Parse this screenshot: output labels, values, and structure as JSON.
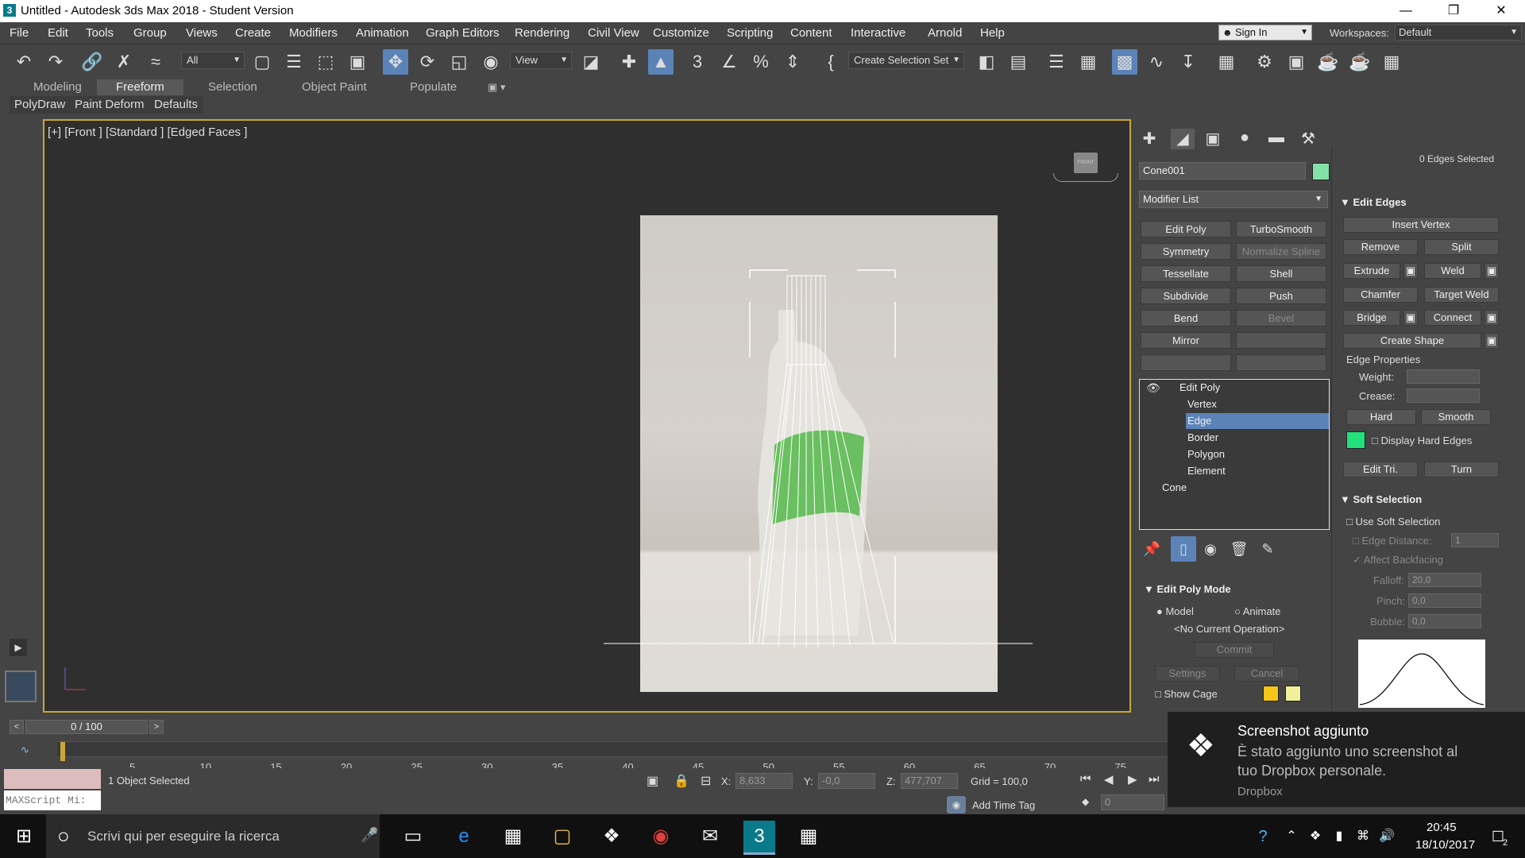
{
  "titlebar": {
    "title": "Untitled - Autodesk 3ds Max 2018 - Student Version",
    "app_icon": "3",
    "minimize": "—",
    "maximize": "❐",
    "close": "✕"
  },
  "menu": [
    "File",
    "Edit",
    "Tools",
    "Group",
    "Views",
    "Create",
    "Modifiers",
    "Animation",
    "Graph Editors",
    "Rendering",
    "Civil View",
    "Customize",
    "Scripting",
    "Content",
    "Interactive",
    "Arnold",
    "Help"
  ],
  "signin": {
    "label": "Sign In"
  },
  "workspace": {
    "label": "Workspaces:",
    "value": "Default"
  },
  "toolbar": {
    "filter": "All",
    "refcoord": "View",
    "selset": "Create Selection Set"
  },
  "ribbon_tabs": [
    "Modeling",
    "Freeform",
    "Selection",
    "Object Paint",
    "Populate"
  ],
  "ribbon_active": "Freeform",
  "ribbon_sub": [
    "PolyDraw",
    "Paint Deform",
    "Defaults"
  ],
  "viewport": {
    "label": "[+] [Front ] [Standard ] [Edged Faces ]",
    "viewcube": "FRONT"
  },
  "panel": {
    "object_name": "Cone001",
    "modifier_list": "Modifier List",
    "buttons": [
      {
        "label": "Edit Poly",
        "enabled": true
      },
      {
        "label": "TurboSmooth",
        "enabled": true
      },
      {
        "label": "Symmetry",
        "enabled": true
      },
      {
        "label": "Normalize Spline",
        "enabled": false
      },
      {
        "label": "Tessellate",
        "enabled": true
      },
      {
        "label": "Shell",
        "enabled": true
      },
      {
        "label": "Subdivide",
        "enabled": true
      },
      {
        "label": "Push",
        "enabled": true
      },
      {
        "label": "Bend",
        "enabled": true
      },
      {
        "label": "Bevel",
        "enabled": false
      },
      {
        "label": "Mirror",
        "enabled": true
      },
      {
        "label": "",
        "enabled": false
      },
      {
        "label": "",
        "enabled": false
      },
      {
        "label": "",
        "enabled": false
      }
    ],
    "stack": [
      {
        "label": "Edit Poly",
        "level": 0,
        "selected": false
      },
      {
        "label": "Vertex",
        "level": 1,
        "selected": false
      },
      {
        "label": "Edge",
        "level": 1,
        "selected": true
      },
      {
        "label": "Border",
        "level": 1,
        "selected": false
      },
      {
        "label": "Polygon",
        "level": 1,
        "selected": false
      },
      {
        "label": "Element",
        "level": 1,
        "selected": false
      },
      {
        "label": "Cone",
        "level": 0,
        "selected": false
      }
    ],
    "edit_poly_mode": {
      "title": "Edit Poly Mode",
      "model": "Model",
      "animate": "Animate",
      "operation": "<No Current Operation>",
      "commit": "Commit",
      "settings": "Settings",
      "cancel": "Cancel",
      "show_cage": "Show Cage",
      "cage_color1": "#f5c518",
      "cage_color2": "#f2ef9a"
    }
  },
  "edges": {
    "selected_count": "0 Edges Selected",
    "title": "Edit Edges",
    "insert_vertex": "Insert Vertex",
    "remove": "Remove",
    "split": "Split",
    "extrude": "Extrude",
    "weld": "Weld",
    "chamfer": "Chamfer",
    "target_weld": "Target Weld",
    "bridge": "Bridge",
    "connect": "Connect",
    "create_shape": "Create Shape",
    "edge_props": "Edge Properties",
    "weight": "Weight:",
    "crease": "Crease:",
    "hard": "Hard",
    "smooth": "Smooth",
    "display_hard": "Display Hard Edges",
    "hard_color": "#22e07a",
    "edit_tri": "Edit Tri.",
    "turn": "Turn"
  },
  "soft": {
    "title": "Soft Selection",
    "use": "Use Soft Selection",
    "edge_distance": "Edge Distance:",
    "edge_distance_val": "1",
    "affect_back": "Affect Backfacing",
    "falloff": "Falloff:",
    "falloff_val": "20,0",
    "pinch": "Pinch:",
    "pinch_val": "0,0",
    "bubble": "Bubble:",
    "bubble_val": "0,0"
  },
  "timeline": {
    "frame": "0 / 100",
    "ticks": [
      "5",
      "10",
      "15",
      "20",
      "25",
      "30",
      "35",
      "40",
      "45",
      "50",
      "55",
      "60",
      "65",
      "70",
      "75"
    ]
  },
  "status": {
    "maxscript": "MAXScript Mi:",
    "selected": "1 Object Selected",
    "x_label": "X:",
    "x": "8,633",
    "y_label": "Y:",
    "y": "-0,0",
    "z_label": "Z:",
    "z": "477,707",
    "grid": "Grid = 100,0",
    "add_time_tag": "Add Time Tag",
    "frame": "0"
  },
  "toast": {
    "title": "Screenshot aggiunto",
    "body1": "È stato aggiunto uno screenshot al",
    "body2": "tuo Dropbox personale.",
    "source": "Dropbox"
  },
  "taskbar": {
    "search": "Scrivi qui per eseguire la ricerca",
    "time": "20:45",
    "date": "18/10/2017",
    "notif": "2"
  }
}
